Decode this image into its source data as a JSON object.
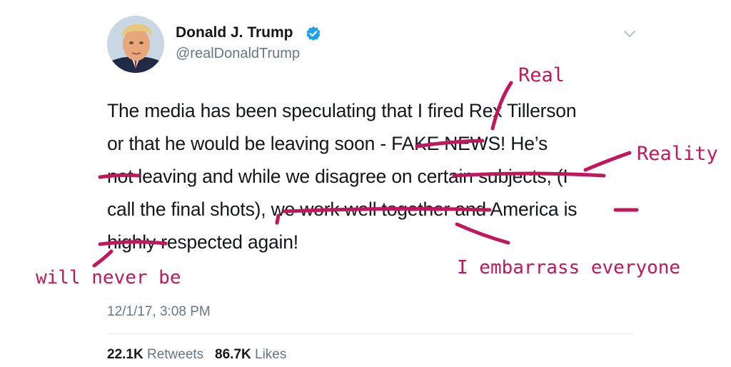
{
  "header": {
    "display_name": "Donald J. Trump",
    "handle": "@realDonaldTrump",
    "verified_icon": "verified-badge-icon",
    "menu_icon": "chevron-down-icon"
  },
  "tweet": {
    "lines": [
      "The media has been speculating that I fired Rex Tillerson",
      "or that he would be leaving soon - FAKE NEWS! He’s",
      "not leaving and while we disagree on certain subjects, (I",
      "call the final shots), we work well together and America is",
      "highly respected again!"
    ],
    "timestamp": "12/1/17, 3:08 PM"
  },
  "stats": {
    "retweets_count": "22.1K",
    "retweets_label": "Retweets",
    "likes_count": "86.7K",
    "likes_label": "Likes"
  },
  "annotations": {
    "real": "Real",
    "reality": "Reality",
    "embarrass": "I embarrass everyone",
    "never": "will never be",
    "color": "#c2185b"
  }
}
